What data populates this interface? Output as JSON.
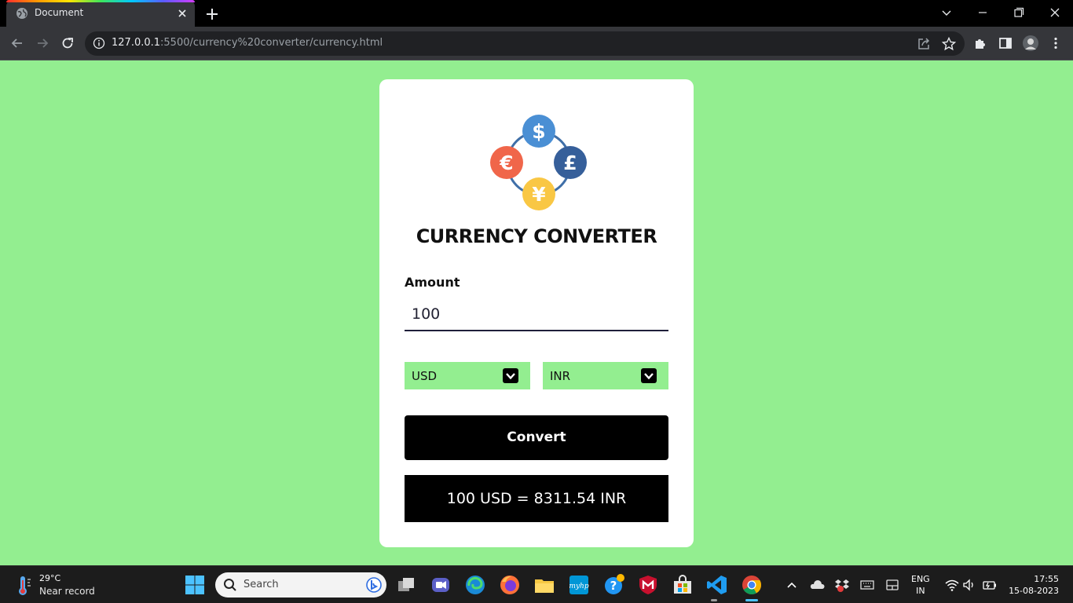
{
  "browser": {
    "tab_title": "Document",
    "url_host": "127.0.0.1",
    "url_rest": ":5500/currency%20converter/currency.html",
    "icons": [
      "globe-icon",
      "close-icon",
      "plus-icon",
      "chevron-down-icon",
      "minimize-icon",
      "restore-icon",
      "back-icon",
      "forward-icon",
      "reload-icon",
      "info-icon",
      "share-icon",
      "star-icon",
      "extensions-icon",
      "side-panel-icon",
      "profile-avatar",
      "menu-icon"
    ]
  },
  "app": {
    "title": "CURRENCY CONVERTER",
    "amount_label": "Amount",
    "amount_value": "100",
    "from_currency": "USD",
    "to_currency": "INR",
    "convert_label": "Convert",
    "result_text": "100 USD = 8311.54 INR",
    "logo_symbols": {
      "top": "$",
      "left": "€",
      "right": "£",
      "bottom": "¥"
    },
    "colors": {
      "page_bg": "#93ee90",
      "card_bg": "#ffffff",
      "button_bg": "#000000",
      "select_bg": "#93ee90",
      "coin_dollar": "#4a8fd4",
      "coin_euro": "#f0664a",
      "coin_pound": "#365f9a",
      "coin_yen": "#f9c744"
    }
  },
  "taskbar": {
    "weather_temp": "29°C",
    "weather_desc": "Near record",
    "search_placeholder": "Search",
    "lang_line1": "ENG",
    "lang_line2": "IN",
    "time": "17:55",
    "date": "15-08-2023",
    "apps": [
      "windows-start-icon",
      "task-view-icon",
      "teams-chat-icon",
      "edge-icon",
      "firefox-icon",
      "file-explorer-icon",
      "myhp-icon",
      "help-icon",
      "mcafee-icon",
      "store-icon",
      "vscode-icon",
      "chrome-icon"
    ]
  }
}
